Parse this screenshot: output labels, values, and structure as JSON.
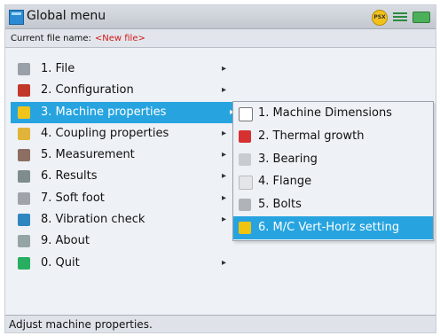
{
  "window": {
    "title": "Global menu",
    "status_badge": "PSX"
  },
  "file_bar": {
    "label": "Current file name:",
    "file_name": "<New file>"
  },
  "menu": {
    "items": [
      {
        "label": "1. File",
        "icon": "file-icon",
        "color": "#9aa0a8"
      },
      {
        "label": "2. Configuration",
        "icon": "configuration-icon",
        "color": "#c0392b"
      },
      {
        "label": "3. Machine properties",
        "icon": "machine-properties-icon",
        "color": "#f0c419"
      },
      {
        "label": "4. Coupling properties",
        "icon": "coupling-icon",
        "color": "#e0b43a"
      },
      {
        "label": "5. Measurement",
        "icon": "measurement-icon",
        "color": "#8d6e63"
      },
      {
        "label": "6. Results",
        "icon": "results-icon",
        "color": "#7f8c8d"
      },
      {
        "label": "7. Soft foot",
        "icon": "soft-foot-icon",
        "color": "#a0a4aa"
      },
      {
        "label": "8. Vibration check",
        "icon": "vibration-icon",
        "color": "#2e86c1"
      },
      {
        "label": "9. About",
        "icon": "about-icon",
        "color": "#95a5a6"
      },
      {
        "label": "0. Quit",
        "icon": "quit-icon",
        "color": "#27ae60"
      }
    ],
    "arrow": "▸"
  },
  "submenu": {
    "items": [
      {
        "label": "1. Machine Dimensions",
        "icon": "dimensions-icon",
        "color": "#ffffff"
      },
      {
        "label": "2. Thermal growth",
        "icon": "thermal-growth-icon",
        "color": "#d63031"
      },
      {
        "label": "3. Bearing",
        "icon": "bearing-icon",
        "color": "#c8ccd1"
      },
      {
        "label": "4. Flange",
        "icon": "flange-icon",
        "color": "#e3e5e8"
      },
      {
        "label": "5. Bolts",
        "icon": "bolts-icon",
        "color": "#b0b4b9"
      },
      {
        "label": "6. M/C Vert-Horiz setting",
        "icon": "vert-horiz-icon",
        "color": "#f1c40f"
      }
    ]
  },
  "help_text": "Adjust machine properties."
}
